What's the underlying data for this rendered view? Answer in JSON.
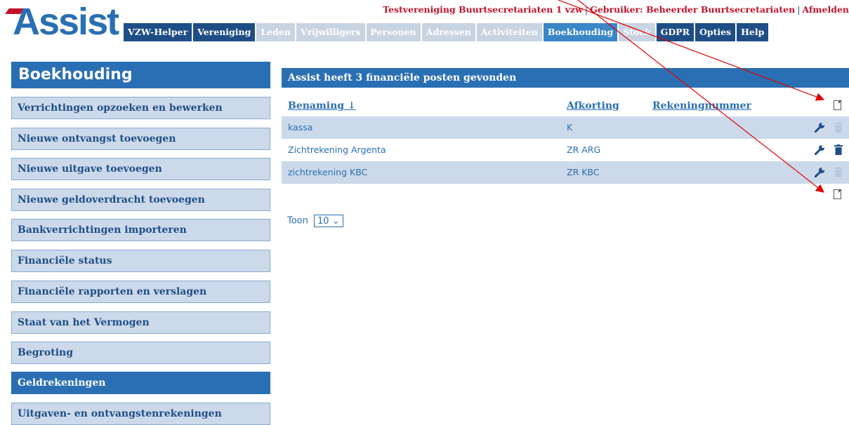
{
  "header": {
    "org": "Testvereniging Buurtsecretariaten 1 vzw",
    "user": "Gebruiker: Beheerder Buurtsecretariaten",
    "logout": "Afmelden",
    "logo": "Assist"
  },
  "nav": [
    {
      "label": "VZW-Helper",
      "state": "normal"
    },
    {
      "label": "Vereniging",
      "state": "normal"
    },
    {
      "label": "Leden",
      "state": "disabled"
    },
    {
      "label": "Vrijwilligers",
      "state": "disabled"
    },
    {
      "label": "Personen",
      "state": "disabled"
    },
    {
      "label": "Adressen",
      "state": "disabled"
    },
    {
      "label": "Activiteiten",
      "state": "disabled"
    },
    {
      "label": "Boekhouding",
      "state": "active"
    },
    {
      "label": "Stock",
      "state": "disabled"
    },
    {
      "label": "GDPR",
      "state": "normal"
    },
    {
      "label": "Opties",
      "state": "normal"
    },
    {
      "label": "Help",
      "state": "normal"
    }
  ],
  "sidebar": {
    "title": "Boekhouding",
    "items": [
      {
        "label": "Verrichtingen opzoeken en bewerken",
        "active": false
      },
      {
        "label": "Nieuwe ontvangst toevoegen",
        "active": false
      },
      {
        "label": "Nieuwe uitgave toevoegen",
        "active": false
      },
      {
        "label": "Nieuwe geldoverdracht toevoegen",
        "active": false
      },
      {
        "label": "Bankverrichtingen importeren",
        "active": false
      },
      {
        "label": "Financiële status",
        "active": false
      },
      {
        "label": "Financiële rapporten en verslagen",
        "active": false
      },
      {
        "label": "Staat van het Vermogen",
        "active": false
      },
      {
        "label": "Begroting",
        "active": false
      },
      {
        "label": "Geldrekeningen",
        "active": true
      },
      {
        "label": "Uitgaven- en ontvangstenrekeningen",
        "active": false
      }
    ]
  },
  "main": {
    "title": "Assist heeft 3 financiële posten gevonden",
    "columns": {
      "name": "Benaming ↓",
      "abbr": "Afkorting",
      "account": "Rekeningnummer"
    },
    "rows": [
      {
        "name": "kassa",
        "abbr": "K",
        "account": ""
      },
      {
        "name": "Zichtrekening Argenta",
        "abbr": "ZR ARG",
        "account": ""
      },
      {
        "name": "zichtrekening KBC",
        "abbr": "ZR KBC",
        "account": ""
      }
    ],
    "show_label": "Toon",
    "page_size": "10"
  },
  "colors": {
    "accent": "#2a6fb3",
    "navy": "#1f4e86",
    "brand_red": "#c0132c",
    "row_shade": "#ccd9ea"
  },
  "icons": {
    "edit": "wrench-icon",
    "delete": "trash-icon",
    "add": "new-document-icon"
  }
}
